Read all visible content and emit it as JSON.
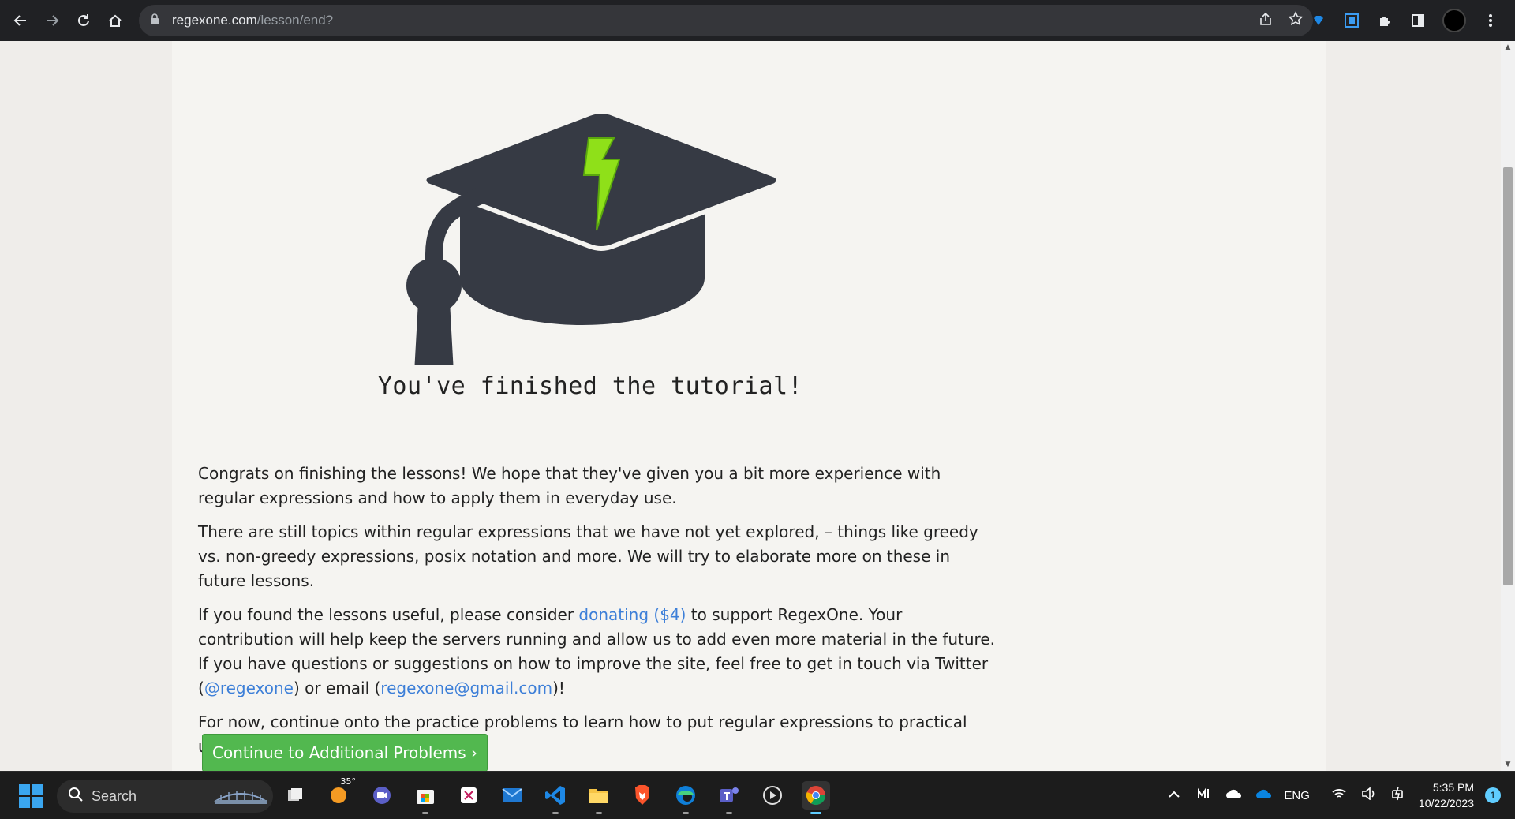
{
  "browser": {
    "url_host": "regexone.com",
    "url_path": "/lesson/end?"
  },
  "page": {
    "heading": "You've finished the tutorial!",
    "paragraphs": {
      "p1": "Congrats on finishing the lessons! We hope that they've given you a bit more experience with regular expressions and how to apply them in everyday use.",
      "p2": "There are still topics within regular expressions that we have not yet explored, – things like greedy vs. non-greedy expressions, posix notation and more. We will try to elaborate more on these in future lessons.",
      "p3_before": "If you found the lessons useful, please consider ",
      "p3_donate_link": "donating ($4)",
      "p3_middle": " to support RegexOne. Your contribution will help keep the servers running and allow us to add even more material in the future. If you have questions or suggestions on how to improve the site, feel free to get in touch via Twitter (",
      "p3_twitter_link": "@regexone",
      "p3_after": ") or email (",
      "p3_email_link": "regexone@gmail.com",
      "p3_end": ")!",
      "p4": "For now, continue onto the practice problems to learn how to put regular expressions to practical use."
    },
    "continue_button": "Continue to Additional Problems ›"
  },
  "taskbar": {
    "search_label": "Search",
    "weather_temp": "35°",
    "language": "ENG",
    "time": "5:35 PM",
    "date": "10/22/2023",
    "notification_count": "1"
  },
  "colors": {
    "link": "#3d7fd8",
    "button_green": "#52b84f",
    "cap_dark": "#363a44",
    "bolt_green": "#8fe019"
  }
}
